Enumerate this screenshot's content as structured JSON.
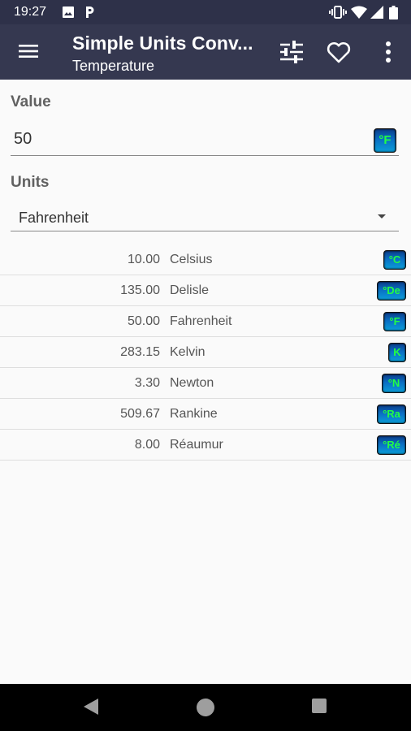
{
  "status_bar": {
    "time": "19:27",
    "icons": [
      "image-icon",
      "parking-p-icon",
      "vibrate-icon",
      "wifi-icon",
      "signal-icon",
      "battery-icon"
    ]
  },
  "app_bar": {
    "title": "Simple Units Conv...",
    "subtitle": "Temperature",
    "actions": [
      "menu-icon",
      "tune-sliders-icon",
      "heart-outline-icon",
      "more-vert-icon"
    ]
  },
  "form": {
    "value_label": "Value",
    "value": "50",
    "value_unit_badge": "°F",
    "units_label": "Units",
    "units_selected": "Fahrenheit"
  },
  "results": [
    {
      "value": "10.00",
      "unit": "Celsius",
      "badge": "°C"
    },
    {
      "value": "135.00",
      "unit": "Delisle",
      "badge": "°De"
    },
    {
      "value": "50.00",
      "unit": "Fahrenheit",
      "badge": "°F"
    },
    {
      "value": "283.15",
      "unit": "Kelvin",
      "badge": "K"
    },
    {
      "value": "3.30",
      "unit": "Newton",
      "badge": "°N"
    },
    {
      "value": "509.67",
      "unit": "Rankine",
      "badge": "°Ra"
    },
    {
      "value": "8.00",
      "unit": "Réaumur",
      "badge": "°Ré"
    }
  ],
  "nav_bar": [
    "back-icon",
    "home-icon",
    "recents-icon"
  ],
  "colors": {
    "status_bar_bg": "#2e3149",
    "app_bar_bg": "#353850",
    "badge_text": "#22ff44",
    "badge_bg": "#0a6fc4"
  }
}
